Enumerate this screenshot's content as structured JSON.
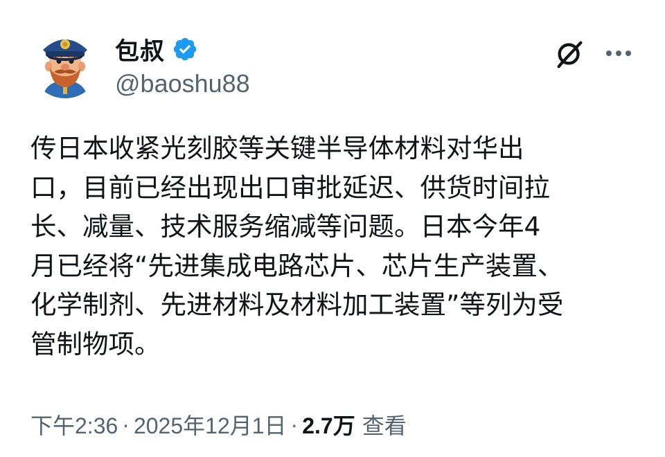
{
  "author": {
    "display_name": "包叔",
    "handle": "@baoshu88",
    "verified": true,
    "avatar_icon": "police-cartoon-avatar",
    "verified_badge_color": "#1d9bf0"
  },
  "actions": {
    "grok_icon": "grok-icon",
    "more_icon": "more-icon"
  },
  "post": {
    "text": "传日本收紧光刻胶等关键半导体材料对华出\n口，目前已经出现出口审批延迟、供货时间拉\n长、减量、技术服务缩减等问题。日本今年4\n月已经将“先进集成电路芯片、芯片生产装置、\n化学制剂、先进材料及材料加工装置”等列为受\n管制物项。"
  },
  "meta": {
    "time": "下午2:36",
    "separator": "·",
    "date": "2025年12月1日",
    "views_count": "2.7万",
    "views_label": "查看"
  },
  "colors": {
    "text_primary": "#0f1419",
    "text_secondary": "#536471",
    "accent": "#1d9bf0"
  }
}
